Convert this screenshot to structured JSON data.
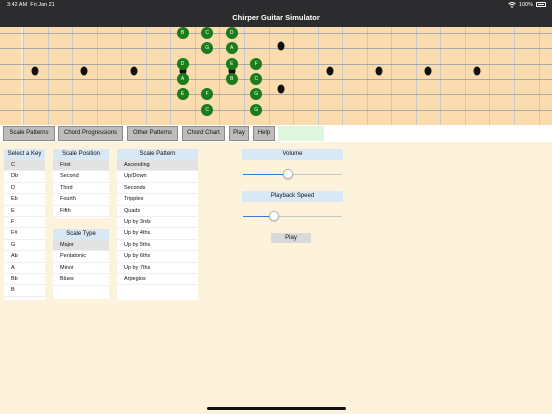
{
  "status_bar": {
    "time": "3:42 AM",
    "date": "Fri Jan 21",
    "battery": "100%",
    "wifi_icon": "wifi-icon",
    "battery_icon": "battery-icon"
  },
  "app": {
    "title": "Chirper Guitar Simulator"
  },
  "fretboard": {
    "frets": 21,
    "strings": 6,
    "inlay_frets": [
      2,
      4,
      6,
      8,
      10,
      12,
      14,
      16,
      18,
      20
    ],
    "notes": [
      {
        "fret": 8,
        "string": 1,
        "label": "B"
      },
      {
        "fret": 9,
        "string": 1,
        "label": "C"
      },
      {
        "fret": 10,
        "string": 1,
        "label": "D"
      },
      {
        "fret": 9,
        "string": 2,
        "label": "G"
      },
      {
        "fret": 10,
        "string": 2,
        "label": "A"
      },
      {
        "fret": 8,
        "string": 3,
        "label": "D"
      },
      {
        "fret": 10,
        "string": 3,
        "label": "E"
      },
      {
        "fret": 11,
        "string": 3,
        "label": "F"
      },
      {
        "fret": 8,
        "string": 4,
        "label": "A"
      },
      {
        "fret": 10,
        "string": 4,
        "label": "B"
      },
      {
        "fret": 11,
        "string": 4,
        "label": "C"
      },
      {
        "fret": 8,
        "string": 5,
        "label": "E"
      },
      {
        "fret": 9,
        "string": 5,
        "label": "F"
      },
      {
        "fret": 11,
        "string": 5,
        "label": "G"
      },
      {
        "fret": 9,
        "string": 6,
        "label": "C"
      },
      {
        "fret": 11,
        "string": 6,
        "label": "G"
      }
    ]
  },
  "toolbar": {
    "scale_patterns": "Scale Patterns",
    "chord_progressions": "Chord Progressions",
    "other_patterns": "Other Patterns",
    "chord_chart": "Chord Chart",
    "play": "Play",
    "help": "Help"
  },
  "key_panel": {
    "header": "Select a Key",
    "items": [
      "C",
      "Db",
      "D",
      "Eb",
      "E",
      "F",
      "F#",
      "G",
      "Ab",
      "A",
      "Bb",
      "B"
    ],
    "selected": 0
  },
  "position_panel": {
    "header": "Scale Position",
    "items": [
      "First",
      "Second",
      "Third",
      "Fourth",
      "Fifth"
    ],
    "selected": 0
  },
  "type_panel": {
    "header": "Scale Type",
    "items": [
      "Major",
      "Pentatonic",
      "Minor",
      "Blues"
    ],
    "selected": 0
  },
  "pattern_panel": {
    "header": "Scale Pattern",
    "items": [
      "Ascending",
      "Up/Down",
      "Seconds",
      "Tripples",
      "Quads",
      "Up by 3rds",
      "Up by 4ths",
      "Up by 5ths",
      "Up by 6ths",
      "Up by 7ths",
      "Arpegios"
    ],
    "selected": 0
  },
  "controls": {
    "volume_label": "Volume",
    "volume_level": 0.45,
    "speed_label": "Playback Speed",
    "speed_level": 0.31,
    "play_label": "Play"
  },
  "colors": {
    "note": "#1b7c1b",
    "panel_header": "#d8e8f5",
    "accent": "#2f7fd6",
    "background": "#fdf3dc",
    "fretboard": "#fbdcae"
  }
}
